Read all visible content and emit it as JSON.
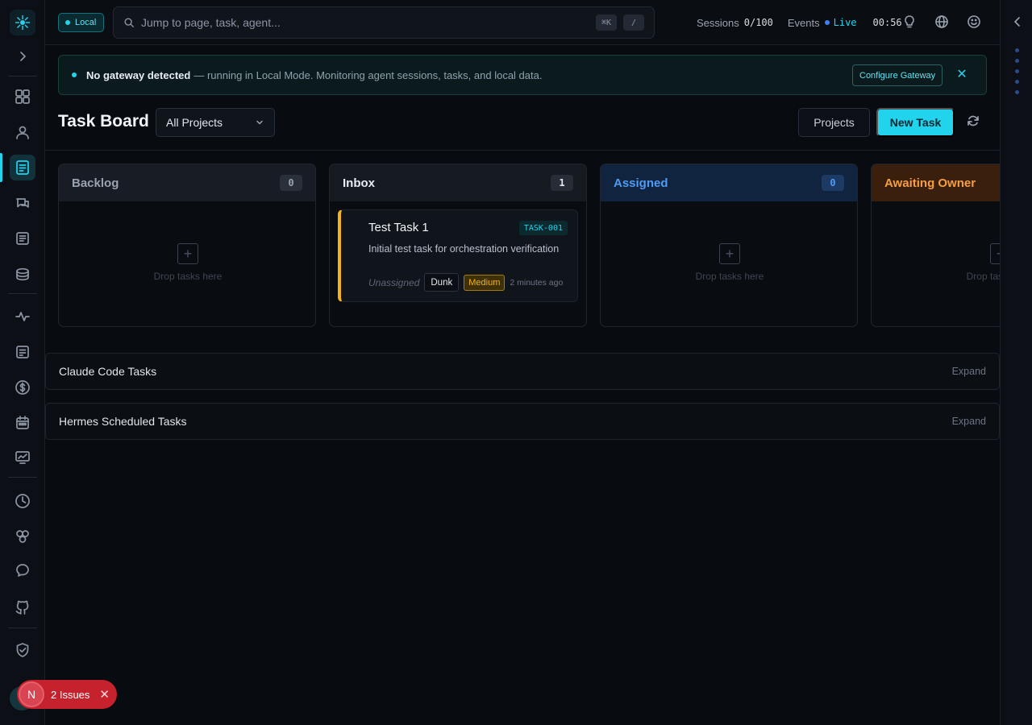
{
  "topbar": {
    "mode_label": "Local",
    "search_placeholder": "Jump to page, task, agent...",
    "shortcut_key": "⌘K",
    "shortcut_slash": "/",
    "sessions_label": "Sessions",
    "sessions_value": "0/100",
    "events_label": "Events",
    "live_label": "Live",
    "clock": "00:56",
    "icons": [
      "lightbulb-icon",
      "globe-icon",
      "smiley-icon"
    ]
  },
  "banner": {
    "strong_text": "No gateway detected",
    "rest_text": "— running in Local Mode. Monitoring agent sessions, tasks, and local data.",
    "configure_label": "Configure Gateway",
    "close_glyph": "✕"
  },
  "header": {
    "title": "Task Board",
    "project_filter": "All Projects",
    "projects_button": "Projects",
    "new_task_button": "New Task"
  },
  "columns": [
    {
      "name": "Backlog",
      "count": "0",
      "drop_text": "Drop tasks here",
      "color": "#9aa3b0"
    },
    {
      "name": "Inbox",
      "count": "1",
      "color": "#e8edf3"
    },
    {
      "name": "Assigned",
      "count": "0",
      "drop_text": "Drop tasks here",
      "color": "#4f9cf2"
    },
    {
      "name": "Awaiting Owner",
      "count": "",
      "drop_text": "Drop tasks here",
      "color": "#f59e42"
    }
  ],
  "task": {
    "title": "Test Task 1",
    "id": "TASK-001",
    "description": "Initial test task for orchestration verification",
    "assignee": "Unassigned",
    "agent": "Dunk",
    "priority": "Medium",
    "time_ago": "2 minutes ago",
    "priority_color": "#f5b31b"
  },
  "sections": [
    {
      "title": "Claude Code Tasks",
      "action": "Expand"
    },
    {
      "title": "Hermes Scheduled Tasks",
      "action": "Expand"
    }
  ],
  "issues_toast": {
    "avatar_letter": "N",
    "label": "2 Issues",
    "close_glyph": "✕"
  },
  "sidebar": {
    "icons": [
      "overview-icon",
      "agents-icon",
      "tasks-icon",
      "chat-icon",
      "logs-icon",
      "database-icon",
      "activity-icon",
      "notes-icon",
      "cost-icon",
      "calendar-icon",
      "monitor-icon",
      "history-icon",
      "integrations-icon",
      "memory-icon",
      "github-icon",
      "security-icon",
      "settings-icon"
    ],
    "active": "tasks-icon"
  },
  "accent_color": "#22d3ee"
}
